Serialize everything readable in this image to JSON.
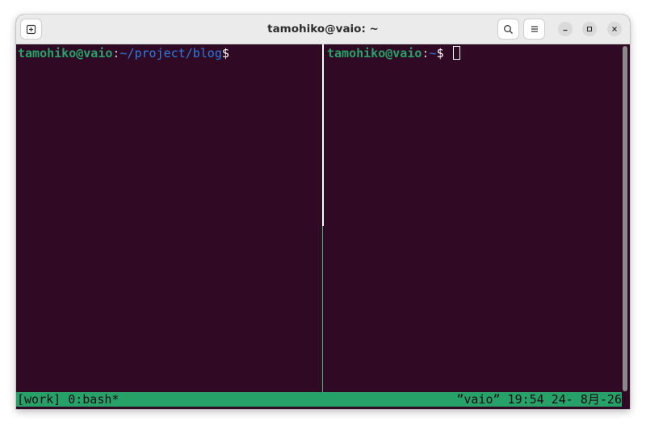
{
  "window": {
    "title": "tamohiko@vaio: ~"
  },
  "titlebar": {
    "new_tab_icon": "new-tab-icon",
    "search_icon": "search-icon",
    "menu_icon": "hamburger-menu-icon",
    "minimize_icon": "minimize-icon",
    "maximize_icon": "maximize-icon",
    "close_icon": "close-icon"
  },
  "left_pane": {
    "user_host": "tamohiko@vaio",
    "colon": ":",
    "path": "~/project/blog",
    "dollar": "$"
  },
  "right_pane": {
    "user_host": "tamohiko@vaio",
    "colon": ":",
    "path": "~",
    "dollar": "$ "
  },
  "tmux": {
    "left": "[work] 0:bash*",
    "right": "”vaio” 19:54 24- 8月-26"
  },
  "colors": {
    "terminal_bg": "#300a24",
    "prompt_user": "#26a269",
    "prompt_path": "#2a7bde",
    "status_bar": "#26a269",
    "titlebar_bg": "#ebebeb"
  }
}
